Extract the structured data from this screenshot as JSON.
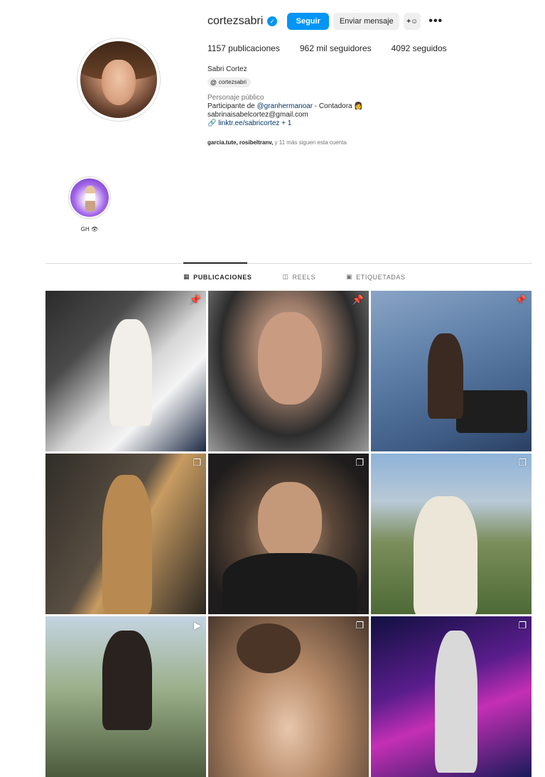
{
  "profile": {
    "username": "cortezsabri",
    "verified_mark": "✓",
    "follow_label": "Seguir",
    "message_label": "Enviar mensaje",
    "add_user_icon": "add-user-icon",
    "more_label": "•••",
    "stats": {
      "posts": "1157 publicaciones",
      "followers": "962 mil seguidores",
      "following": "4092 seguidos"
    },
    "full_name": "Sabri Cortez",
    "threads_handle": "cortezsabri",
    "category": "Personaje público",
    "bio_prefix": "Participante de ",
    "bio_mention": "@granhermanoar",
    "bio_suffix": " - Contadora 👩",
    "email": "sabrinaisabelcortez@gmail.com",
    "link": "linktr.ee/sabricortez + 1",
    "followed_by_names": "garcia.tute, rosibeltranv,",
    "followed_by_rest": " y 11 más siguen esta cuenta"
  },
  "highlights": [
    {
      "label": "GH 👁"
    }
  ],
  "tabs": [
    {
      "label": "PUBLICACIONES",
      "icon": "grid-icon",
      "active": true
    },
    {
      "label": "REELS",
      "icon": "reels-icon",
      "active": false
    },
    {
      "label": "ETIQUETADAS",
      "icon": "tagged-icon",
      "active": false
    }
  ],
  "posts": [
    {
      "badge": "pin-icon"
    },
    {
      "badge": "pin-icon"
    },
    {
      "badge": "pin-icon"
    },
    {
      "badge": "carousel-icon"
    },
    {
      "badge": "carousel-icon"
    },
    {
      "badge": "carousel-icon"
    },
    {
      "badge": "reel-icon"
    },
    {
      "badge": "carousel-icon"
    },
    {
      "badge": "carousel-icon"
    }
  ],
  "colors": {
    "accent": "#0095f6",
    "link": "#00376b",
    "muted": "#737373",
    "border": "#dbdbdb"
  }
}
